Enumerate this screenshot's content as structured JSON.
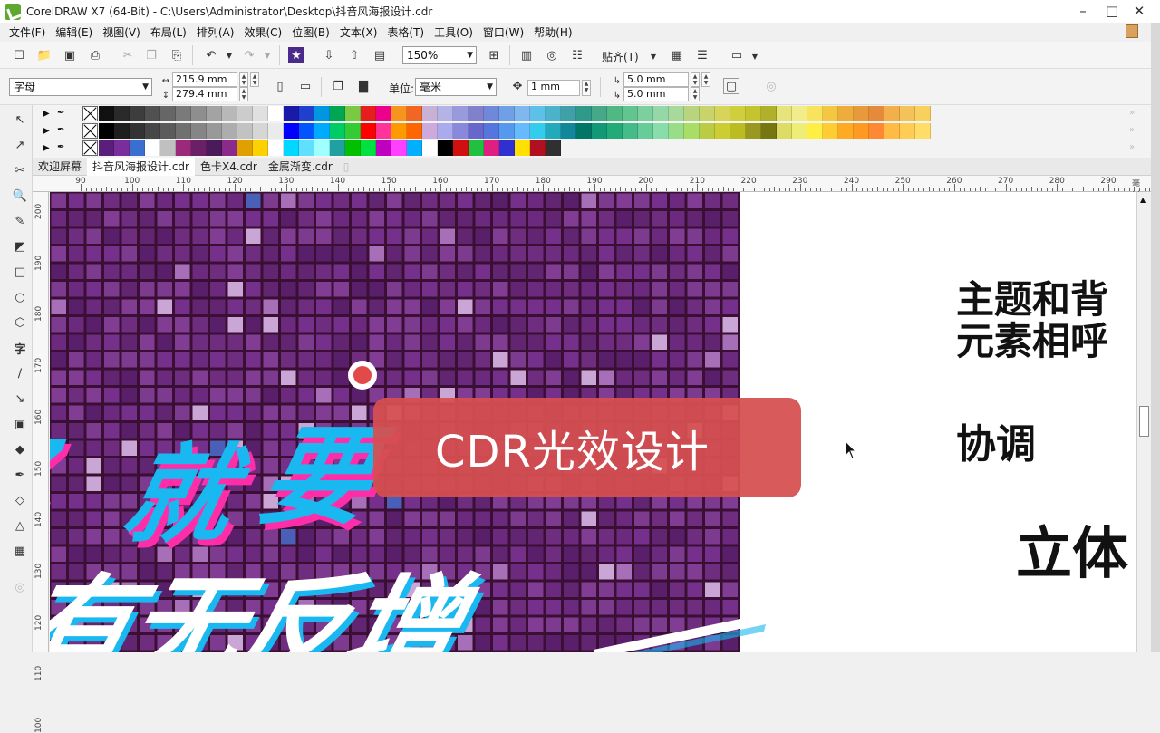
{
  "window": {
    "title": "CorelDRAW X7 (64-Bit) - C:\\Users\\Administrator\\Desktop\\抖音风海报设计.cdr"
  },
  "menu": [
    "文件(F)",
    "编辑(E)",
    "视图(V)",
    "布局(L)",
    "排列(A)",
    "效果(C)",
    "位图(B)",
    "文本(X)",
    "表格(T)",
    "工具(O)",
    "窗口(W)",
    "帮助(H)"
  ],
  "toolbar1": {
    "zoom": "150%",
    "snap_label": "贴齐(T)"
  },
  "toolbar2": {
    "font_combo": "字母",
    "width": "215.9 mm",
    "height": "279.4 mm",
    "unit_label": "单位:",
    "unit_value": "毫米",
    "nudge": "1 mm",
    "dup_x": "5.0 mm",
    "dup_y": "5.0 mm"
  },
  "palette": {
    "row1": [
      "#111111",
      "#2a2a2a",
      "#3d3d3d",
      "#515151",
      "#666666",
      "#7a7a7a",
      "#8e8e8e",
      "#a3a3a3",
      "#b8b8b8",
      "#cccccc",
      "#e0e0e0",
      "#ffffff",
      "#1a1aa8",
      "#1f3fcf",
      "#0096e0",
      "#00a651",
      "#7ac943",
      "#e61e1e",
      "#ec008c",
      "#f7941d",
      "#f26522",
      "#c7b2d6",
      "#b3b3e6",
      "#9999dd",
      "#8080cc",
      "#6f88d9",
      "#6fa0e6",
      "#7fb8ee",
      "#5cc0e8",
      "#4ab3c9",
      "#3fa0a8",
      "#2f9a8a",
      "#44a889",
      "#4fb883",
      "#62c48f",
      "#7dcf9e",
      "#96d7a8",
      "#a8d89a",
      "#b8d47e",
      "#c8d36a",
      "#d6d55a",
      "#cfcf3d",
      "#c4c42e",
      "#b0b02a",
      "#e6e47a",
      "#f2ec8a",
      "#f7e45c",
      "#f4c642",
      "#eead3a",
      "#e89a3a",
      "#e48a3a",
      "#f2b04d",
      "#f4c25a",
      "#f7d05e"
    ],
    "row2": [
      "#000000",
      "#1e1e1e",
      "#333333",
      "#474747",
      "#5b5b5b",
      "#707070",
      "#858585",
      "#999999",
      "#adadad",
      "#c2c2c2",
      "#d6d6d6",
      "#ebebeb",
      "#0000ff",
      "#0055ff",
      "#00aaff",
      "#00cc66",
      "#33cc33",
      "#ff0000",
      "#ff3399",
      "#ff9900",
      "#ff6600",
      "#ccaadd",
      "#aaaaee",
      "#8888dd",
      "#6666cc",
      "#5577dd",
      "#5599ee",
      "#66bbff",
      "#33ccee",
      "#22aabb",
      "#118899",
      "#007766",
      "#119977",
      "#22aa77",
      "#44bb88",
      "#66cc99",
      "#88ddaa",
      "#99dd88",
      "#aadd66",
      "#bbcc44",
      "#cccc33",
      "#bbbb22",
      "#999922",
      "#777711",
      "#dddd66",
      "#eeee77",
      "#ffee44",
      "#ffcc33",
      "#ffaa22",
      "#ff9922",
      "#ff8833",
      "#ffbb44",
      "#ffcc55",
      "#ffdd66"
    ],
    "row3": [
      "#5a1f7a",
      "#7a2e9c",
      "#3a6fcf",
      "#ffffff",
      "#c0c0c0",
      "#9b2a7a",
      "#6a1f66",
      "#4a1a5a",
      "#8a2a8a",
      "#e0a000",
      "#ffd000",
      "#ffffff",
      "#00d8ff",
      "#60e0ff",
      "#a0ffff",
      "#20a0a0",
      "#00c000",
      "#00e040",
      "#c000c0",
      "#ff40ff",
      "#00b0ff",
      "#ffffff",
      "#000000",
      "#d01010",
      "#20c040",
      "#e02080",
      "#3030d0",
      "#ffe000",
      "#b01020",
      "#303030"
    ]
  },
  "tabs": [
    "欢迎屏幕",
    "抖音风海报设计.cdr",
    "色卡X4.cdr",
    "金属渐变.cdr"
  ],
  "ruler": {
    "h_labels": [
      "90",
      "100",
      "110",
      "120",
      "130",
      "140",
      "150",
      "160",
      "170",
      "180",
      "190",
      "200",
      "210",
      "220",
      "230",
      "240",
      "250",
      "260",
      "270",
      "280",
      "290"
    ],
    "h_unit": "毫米",
    "v_labels": [
      "200",
      "190",
      "180",
      "170",
      "160",
      "150",
      "140",
      "130",
      "120",
      "110",
      "100"
    ]
  },
  "poster": {
    "line1_a": "就",
    "line1_b": "要",
    "line2": "有无反增"
  },
  "side_text": {
    "line1": "主题和背",
    "line2": "元素相呼",
    "line3": "协调",
    "line4": "立体"
  },
  "overlay": {
    "banner_text": "CDR光效设计"
  },
  "colors": {
    "poster_base": "#6b2a7e",
    "banner": "#d65050",
    "accent_cyan": "#19b8f0",
    "accent_pink": "#ff2ea8"
  }
}
